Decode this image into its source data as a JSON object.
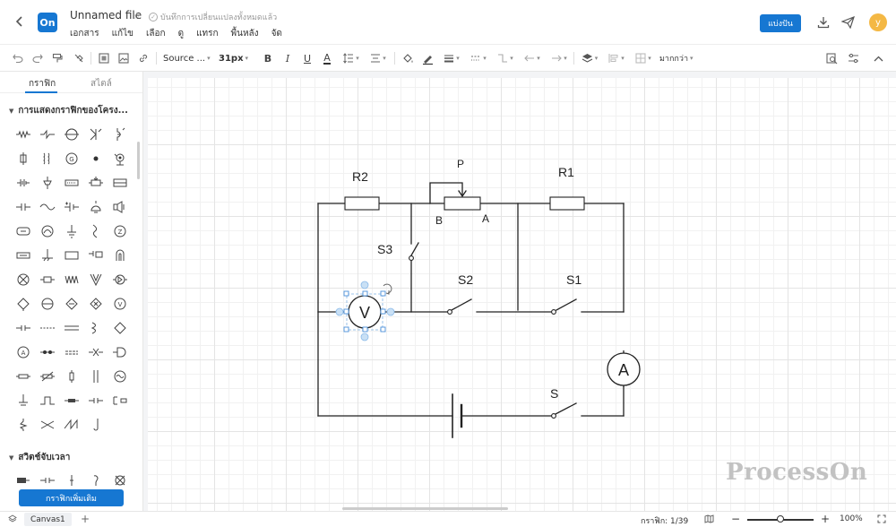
{
  "header": {
    "file_title": "Unnamed file",
    "save_status": "บันทึกการเปลี่ยนแปลงทั้งหมดแล้ว",
    "logo_text": "On",
    "menu": [
      "เอกสาร",
      "แก้ไข",
      "เลือก",
      "ดู",
      "แทรก",
      "พื้นหลัง",
      "จัด"
    ],
    "share_label": "แบ่งปัน",
    "avatar_letter": "y",
    "accent_color": "#1677d2"
  },
  "toolbar": {
    "font_name": "Source ...",
    "font_size": "31px",
    "more_label": "มากกว่า"
  },
  "left_panel": {
    "tab_graphics": "กราฟิก",
    "tab_style": "สไตล์",
    "section1_title": "การแสดงกราฟิกของโครง...",
    "section2_title": "สวิตช์จับเวลา",
    "more_shapes_label": "กราฟิกเพิ่มเติม"
  },
  "diagram": {
    "labels": {
      "r2": "R2",
      "r1": "R1",
      "p": "P",
      "b": "B",
      "a": "A",
      "s3": "S3",
      "s2": "S2",
      "s1": "S1",
      "s": "S",
      "voltmeter": "V",
      "ammeter": "A"
    }
  },
  "watermark": "ProcessOn",
  "bottom_bar": {
    "canvas_tab": "Canvas1",
    "graphics_count": "กราฟิก: 1/39",
    "zoom_level": "100%",
    "zoom_fraction": 0.5
  }
}
